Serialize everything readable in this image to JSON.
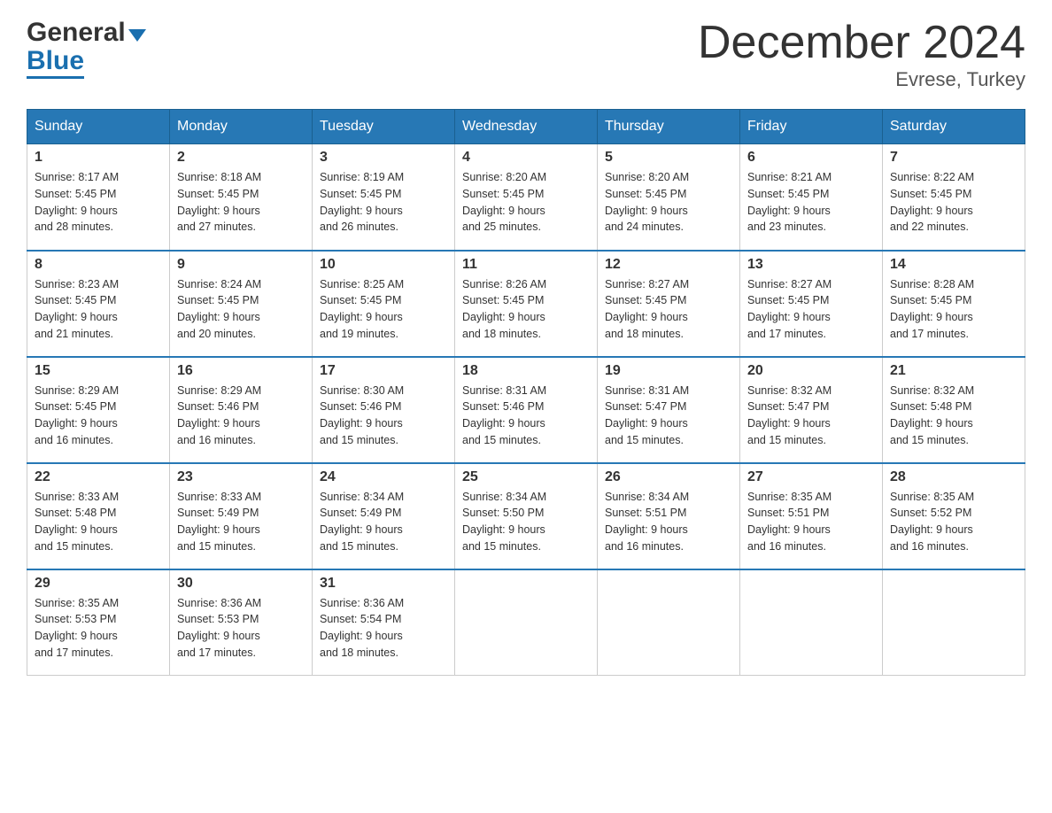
{
  "header": {
    "logo_general": "General",
    "logo_blue": "Blue",
    "month_title": "December 2024",
    "location": "Evrese, Turkey"
  },
  "weekdays": [
    "Sunday",
    "Monday",
    "Tuesday",
    "Wednesday",
    "Thursday",
    "Friday",
    "Saturday"
  ],
  "weeks": [
    [
      {
        "day": "1",
        "sunrise": "Sunrise: 8:17 AM",
        "sunset": "Sunset: 5:45 PM",
        "daylight": "Daylight: 9 hours and 28 minutes."
      },
      {
        "day": "2",
        "sunrise": "Sunrise: 8:18 AM",
        "sunset": "Sunset: 5:45 PM",
        "daylight": "Daylight: 9 hours and 27 minutes."
      },
      {
        "day": "3",
        "sunrise": "Sunrise: 8:19 AM",
        "sunset": "Sunset: 5:45 PM",
        "daylight": "Daylight: 9 hours and 26 minutes."
      },
      {
        "day": "4",
        "sunrise": "Sunrise: 8:20 AM",
        "sunset": "Sunset: 5:45 PM",
        "daylight": "Daylight: 9 hours and 25 minutes."
      },
      {
        "day": "5",
        "sunrise": "Sunrise: 8:20 AM",
        "sunset": "Sunset: 5:45 PM",
        "daylight": "Daylight: 9 hours and 24 minutes."
      },
      {
        "day": "6",
        "sunrise": "Sunrise: 8:21 AM",
        "sunset": "Sunset: 5:45 PM",
        "daylight": "Daylight: 9 hours and 23 minutes."
      },
      {
        "day": "7",
        "sunrise": "Sunrise: 8:22 AM",
        "sunset": "Sunset: 5:45 PM",
        "daylight": "Daylight: 9 hours and 22 minutes."
      }
    ],
    [
      {
        "day": "8",
        "sunrise": "Sunrise: 8:23 AM",
        "sunset": "Sunset: 5:45 PM",
        "daylight": "Daylight: 9 hours and 21 minutes."
      },
      {
        "day": "9",
        "sunrise": "Sunrise: 8:24 AM",
        "sunset": "Sunset: 5:45 PM",
        "daylight": "Daylight: 9 hours and 20 minutes."
      },
      {
        "day": "10",
        "sunrise": "Sunrise: 8:25 AM",
        "sunset": "Sunset: 5:45 PM",
        "daylight": "Daylight: 9 hours and 19 minutes."
      },
      {
        "day": "11",
        "sunrise": "Sunrise: 8:26 AM",
        "sunset": "Sunset: 5:45 PM",
        "daylight": "Daylight: 9 hours and 18 minutes."
      },
      {
        "day": "12",
        "sunrise": "Sunrise: 8:27 AM",
        "sunset": "Sunset: 5:45 PM",
        "daylight": "Daylight: 9 hours and 18 minutes."
      },
      {
        "day": "13",
        "sunrise": "Sunrise: 8:27 AM",
        "sunset": "Sunset: 5:45 PM",
        "daylight": "Daylight: 9 hours and 17 minutes."
      },
      {
        "day": "14",
        "sunrise": "Sunrise: 8:28 AM",
        "sunset": "Sunset: 5:45 PM",
        "daylight": "Daylight: 9 hours and 17 minutes."
      }
    ],
    [
      {
        "day": "15",
        "sunrise": "Sunrise: 8:29 AM",
        "sunset": "Sunset: 5:45 PM",
        "daylight": "Daylight: 9 hours and 16 minutes."
      },
      {
        "day": "16",
        "sunrise": "Sunrise: 8:29 AM",
        "sunset": "Sunset: 5:46 PM",
        "daylight": "Daylight: 9 hours and 16 minutes."
      },
      {
        "day": "17",
        "sunrise": "Sunrise: 8:30 AM",
        "sunset": "Sunset: 5:46 PM",
        "daylight": "Daylight: 9 hours and 15 minutes."
      },
      {
        "day": "18",
        "sunrise": "Sunrise: 8:31 AM",
        "sunset": "Sunset: 5:46 PM",
        "daylight": "Daylight: 9 hours and 15 minutes."
      },
      {
        "day": "19",
        "sunrise": "Sunrise: 8:31 AM",
        "sunset": "Sunset: 5:47 PM",
        "daylight": "Daylight: 9 hours and 15 minutes."
      },
      {
        "day": "20",
        "sunrise": "Sunrise: 8:32 AM",
        "sunset": "Sunset: 5:47 PM",
        "daylight": "Daylight: 9 hours and 15 minutes."
      },
      {
        "day": "21",
        "sunrise": "Sunrise: 8:32 AM",
        "sunset": "Sunset: 5:48 PM",
        "daylight": "Daylight: 9 hours and 15 minutes."
      }
    ],
    [
      {
        "day": "22",
        "sunrise": "Sunrise: 8:33 AM",
        "sunset": "Sunset: 5:48 PM",
        "daylight": "Daylight: 9 hours and 15 minutes."
      },
      {
        "day": "23",
        "sunrise": "Sunrise: 8:33 AM",
        "sunset": "Sunset: 5:49 PM",
        "daylight": "Daylight: 9 hours and 15 minutes."
      },
      {
        "day": "24",
        "sunrise": "Sunrise: 8:34 AM",
        "sunset": "Sunset: 5:49 PM",
        "daylight": "Daylight: 9 hours and 15 minutes."
      },
      {
        "day": "25",
        "sunrise": "Sunrise: 8:34 AM",
        "sunset": "Sunset: 5:50 PM",
        "daylight": "Daylight: 9 hours and 15 minutes."
      },
      {
        "day": "26",
        "sunrise": "Sunrise: 8:34 AM",
        "sunset": "Sunset: 5:51 PM",
        "daylight": "Daylight: 9 hours and 16 minutes."
      },
      {
        "day": "27",
        "sunrise": "Sunrise: 8:35 AM",
        "sunset": "Sunset: 5:51 PM",
        "daylight": "Daylight: 9 hours and 16 minutes."
      },
      {
        "day": "28",
        "sunrise": "Sunrise: 8:35 AM",
        "sunset": "Sunset: 5:52 PM",
        "daylight": "Daylight: 9 hours and 16 minutes."
      }
    ],
    [
      {
        "day": "29",
        "sunrise": "Sunrise: 8:35 AM",
        "sunset": "Sunset: 5:53 PM",
        "daylight": "Daylight: 9 hours and 17 minutes."
      },
      {
        "day": "30",
        "sunrise": "Sunrise: 8:36 AM",
        "sunset": "Sunset: 5:53 PM",
        "daylight": "Daylight: 9 hours and 17 minutes."
      },
      {
        "day": "31",
        "sunrise": "Sunrise: 8:36 AM",
        "sunset": "Sunset: 5:54 PM",
        "daylight": "Daylight: 9 hours and 18 minutes."
      },
      null,
      null,
      null,
      null
    ]
  ]
}
